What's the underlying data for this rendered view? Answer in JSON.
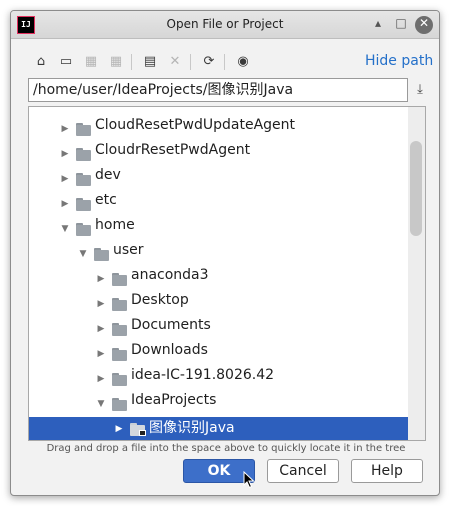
{
  "window": {
    "title": "Open File or Project",
    "app_icon_text": "IJ"
  },
  "toolbar": {
    "icons": [
      "home-icon",
      "desktop-icon",
      "project-folder-icon",
      "module-folder-icon",
      "new-folder-icon",
      "delete-icon",
      "refresh-icon",
      "show-hidden-icon"
    ],
    "hide_path_label": "Hide path"
  },
  "path": {
    "value": "/home/user/IdeaProjects/图像识别Java"
  },
  "tree": {
    "items": [
      {
        "label": "CloudResetPwdUpdateAgent",
        "expanded": false
      },
      {
        "label": "CloudrResetPwdAgent",
        "expanded": false
      },
      {
        "label": "dev",
        "expanded": false
      },
      {
        "label": "etc",
        "expanded": false
      },
      {
        "label": "home",
        "expanded": true
      },
      {
        "label": "user",
        "expanded": true
      },
      {
        "label": "anaconda3",
        "expanded": false
      },
      {
        "label": "Desktop",
        "expanded": false
      },
      {
        "label": "Documents",
        "expanded": false
      },
      {
        "label": "Downloads",
        "expanded": false
      },
      {
        "label": "idea-IC-191.8026.42",
        "expanded": false
      },
      {
        "label": "IdeaProjects",
        "expanded": true
      },
      {
        "label": "图像识别Java",
        "expanded": false,
        "selected": true
      }
    ]
  },
  "hint": "Drag and drop a file into the space above to quickly locate it in the tree",
  "buttons": {
    "ok": "OK",
    "cancel": "Cancel",
    "help": "Help"
  },
  "colors": {
    "selection": "#2d5fbd",
    "link": "#2470c9",
    "primary_button": "#3d6fc9"
  }
}
